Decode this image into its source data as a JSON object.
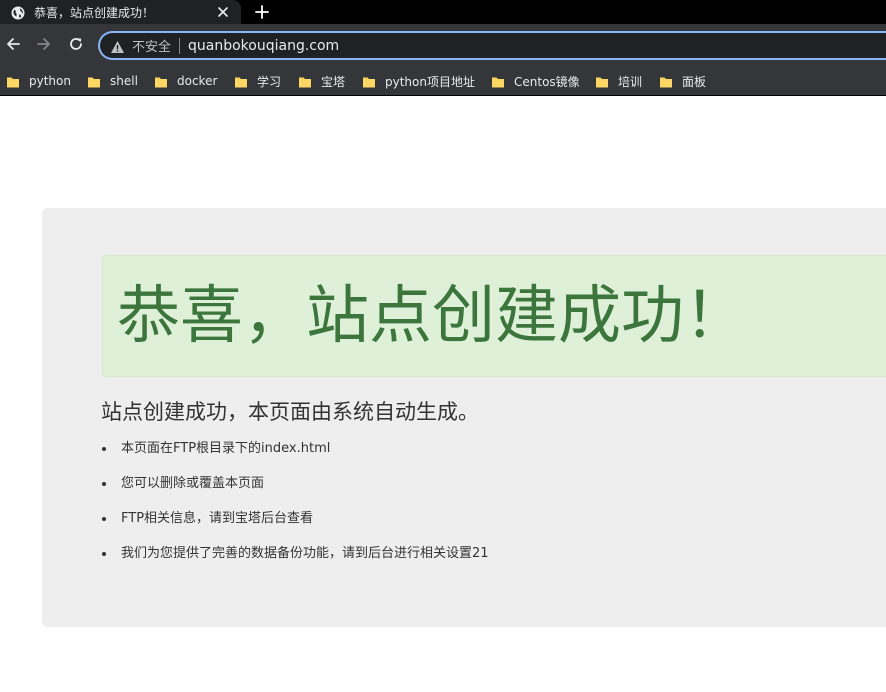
{
  "browser": {
    "tab": {
      "title": "恭喜，站点创建成功！",
      "favicon_icon": "globe-icon",
      "close_icon": "close-icon"
    },
    "new_tab_icon": "plus-icon",
    "nav": {
      "back_icon": "arrow-left-icon",
      "forward_icon": "arrow-right-icon",
      "reload_icon": "reload-icon"
    },
    "omnibox": {
      "security_icon": "warning-triangle-icon",
      "security_text": "不安全",
      "url": "quanbokouqiang.com"
    },
    "bookmarks": [
      {
        "label": "python"
      },
      {
        "label": "shell"
      },
      {
        "label": "docker"
      },
      {
        "label": "学习"
      },
      {
        "label": "宝塔"
      },
      {
        "label": "python项目地址"
      },
      {
        "label": "Centos镜像"
      },
      {
        "label": "培训"
      },
      {
        "label": "面板"
      }
    ],
    "colors": {
      "tabstrip": "#000000",
      "toolbar": "#35363a",
      "omnibox_border": "#8ab4f8",
      "bookmark_folder": "#fdd663"
    }
  },
  "page": {
    "alert_title": "恭喜，站点创建成功！",
    "subtitle": "站点创建成功，本页面由系统自动生成。",
    "list": [
      "本页面在FTP根目录下的index.html",
      "您可以删除或覆盖本页面",
      "FTP相关信息，请到宝塔后台查看",
      "我们为您提供了完善的数据备份功能，请到后台进行相关设置21"
    ],
    "colors": {
      "panel_bg": "#eeeeee",
      "alert_bg": "#dff0d8",
      "alert_text": "#3c763d",
      "body_text": "#333333"
    }
  }
}
